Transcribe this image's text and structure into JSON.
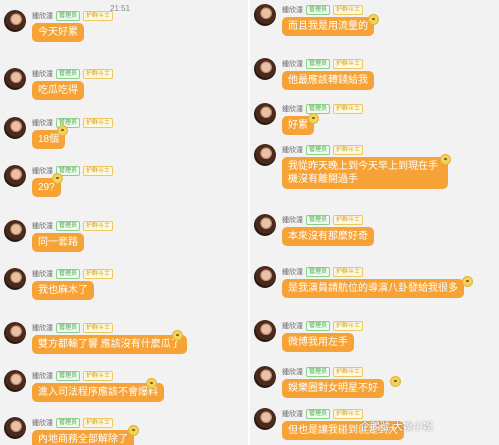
{
  "status_bar": {
    "time": "21:51"
  },
  "sender": {
    "name": "鍾欣潼",
    "admin_tag": "管理员",
    "fan_tag": "护群斗士"
  },
  "left_messages": [
    {
      "text": "今天好累"
    },
    {
      "text": "吃瓜吃得"
    },
    {
      "text": "18個"
    },
    {
      "text": "29?"
    },
    {
      "text": "同一套路"
    },
    {
      "text": "我也麻木了"
    },
    {
      "text": "雙方都輸了響 應該沒有什麼瓜了"
    },
    {
      "text": "進入司法程序應該不會爆料"
    },
    {
      "text": "內地商務全部解除了"
    }
  ],
  "right_messages": [
    {
      "text": "而且我是用流量的"
    },
    {
      "text": "他最應該轉錢給我"
    },
    {
      "text": "好累"
    },
    {
      "text": "我從昨天晚上到今天早上到現在手機沒有離開過手"
    },
    {
      "text": "本來沒有那麼好奇"
    },
    {
      "text": "是我演員請航位的導演八卦發給我很多"
    },
    {
      "text": "微博我用左手"
    },
    {
      "text": "娛樂圈對女明星不好"
    },
    {
      "text": "但也是讓我碰到就是到大"
    }
  ],
  "watermark": {
    "text": "企鵝號 大娛小娛"
  }
}
